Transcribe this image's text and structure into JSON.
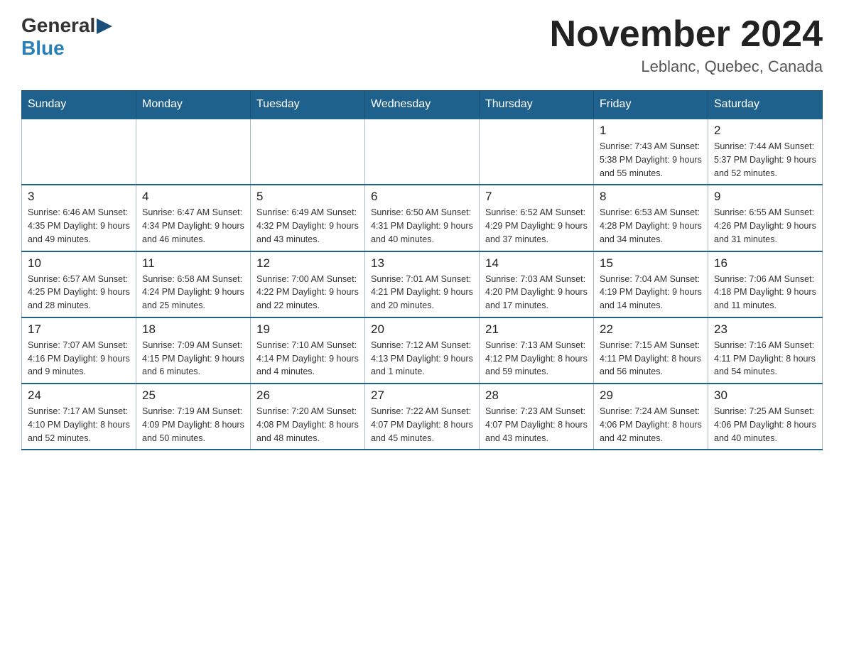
{
  "header": {
    "logo": {
      "general": "General",
      "blue": "Blue"
    },
    "title": "November 2024",
    "location": "Leblanc, Quebec, Canada"
  },
  "calendar": {
    "days_of_week": [
      "Sunday",
      "Monday",
      "Tuesday",
      "Wednesday",
      "Thursday",
      "Friday",
      "Saturday"
    ],
    "weeks": [
      [
        {
          "day": "",
          "info": ""
        },
        {
          "day": "",
          "info": ""
        },
        {
          "day": "",
          "info": ""
        },
        {
          "day": "",
          "info": ""
        },
        {
          "day": "",
          "info": ""
        },
        {
          "day": "1",
          "info": "Sunrise: 7:43 AM\nSunset: 5:38 PM\nDaylight: 9 hours and 55 minutes."
        },
        {
          "day": "2",
          "info": "Sunrise: 7:44 AM\nSunset: 5:37 PM\nDaylight: 9 hours and 52 minutes."
        }
      ],
      [
        {
          "day": "3",
          "info": "Sunrise: 6:46 AM\nSunset: 4:35 PM\nDaylight: 9 hours and 49 minutes."
        },
        {
          "day": "4",
          "info": "Sunrise: 6:47 AM\nSunset: 4:34 PM\nDaylight: 9 hours and 46 minutes."
        },
        {
          "day": "5",
          "info": "Sunrise: 6:49 AM\nSunset: 4:32 PM\nDaylight: 9 hours and 43 minutes."
        },
        {
          "day": "6",
          "info": "Sunrise: 6:50 AM\nSunset: 4:31 PM\nDaylight: 9 hours and 40 minutes."
        },
        {
          "day": "7",
          "info": "Sunrise: 6:52 AM\nSunset: 4:29 PM\nDaylight: 9 hours and 37 minutes."
        },
        {
          "day": "8",
          "info": "Sunrise: 6:53 AM\nSunset: 4:28 PM\nDaylight: 9 hours and 34 minutes."
        },
        {
          "day": "9",
          "info": "Sunrise: 6:55 AM\nSunset: 4:26 PM\nDaylight: 9 hours and 31 minutes."
        }
      ],
      [
        {
          "day": "10",
          "info": "Sunrise: 6:57 AM\nSunset: 4:25 PM\nDaylight: 9 hours and 28 minutes."
        },
        {
          "day": "11",
          "info": "Sunrise: 6:58 AM\nSunset: 4:24 PM\nDaylight: 9 hours and 25 minutes."
        },
        {
          "day": "12",
          "info": "Sunrise: 7:00 AM\nSunset: 4:22 PM\nDaylight: 9 hours and 22 minutes."
        },
        {
          "day": "13",
          "info": "Sunrise: 7:01 AM\nSunset: 4:21 PM\nDaylight: 9 hours and 20 minutes."
        },
        {
          "day": "14",
          "info": "Sunrise: 7:03 AM\nSunset: 4:20 PM\nDaylight: 9 hours and 17 minutes."
        },
        {
          "day": "15",
          "info": "Sunrise: 7:04 AM\nSunset: 4:19 PM\nDaylight: 9 hours and 14 minutes."
        },
        {
          "day": "16",
          "info": "Sunrise: 7:06 AM\nSunset: 4:18 PM\nDaylight: 9 hours and 11 minutes."
        }
      ],
      [
        {
          "day": "17",
          "info": "Sunrise: 7:07 AM\nSunset: 4:16 PM\nDaylight: 9 hours and 9 minutes."
        },
        {
          "day": "18",
          "info": "Sunrise: 7:09 AM\nSunset: 4:15 PM\nDaylight: 9 hours and 6 minutes."
        },
        {
          "day": "19",
          "info": "Sunrise: 7:10 AM\nSunset: 4:14 PM\nDaylight: 9 hours and 4 minutes."
        },
        {
          "day": "20",
          "info": "Sunrise: 7:12 AM\nSunset: 4:13 PM\nDaylight: 9 hours and 1 minute."
        },
        {
          "day": "21",
          "info": "Sunrise: 7:13 AM\nSunset: 4:12 PM\nDaylight: 8 hours and 59 minutes."
        },
        {
          "day": "22",
          "info": "Sunrise: 7:15 AM\nSunset: 4:11 PM\nDaylight: 8 hours and 56 minutes."
        },
        {
          "day": "23",
          "info": "Sunrise: 7:16 AM\nSunset: 4:11 PM\nDaylight: 8 hours and 54 minutes."
        }
      ],
      [
        {
          "day": "24",
          "info": "Sunrise: 7:17 AM\nSunset: 4:10 PM\nDaylight: 8 hours and 52 minutes."
        },
        {
          "day": "25",
          "info": "Sunrise: 7:19 AM\nSunset: 4:09 PM\nDaylight: 8 hours and 50 minutes."
        },
        {
          "day": "26",
          "info": "Sunrise: 7:20 AM\nSunset: 4:08 PM\nDaylight: 8 hours and 48 minutes."
        },
        {
          "day": "27",
          "info": "Sunrise: 7:22 AM\nSunset: 4:07 PM\nDaylight: 8 hours and 45 minutes."
        },
        {
          "day": "28",
          "info": "Sunrise: 7:23 AM\nSunset: 4:07 PM\nDaylight: 8 hours and 43 minutes."
        },
        {
          "day": "29",
          "info": "Sunrise: 7:24 AM\nSunset: 4:06 PM\nDaylight: 8 hours and 42 minutes."
        },
        {
          "day": "30",
          "info": "Sunrise: 7:25 AM\nSunset: 4:06 PM\nDaylight: 8 hours and 40 minutes."
        }
      ]
    ]
  }
}
